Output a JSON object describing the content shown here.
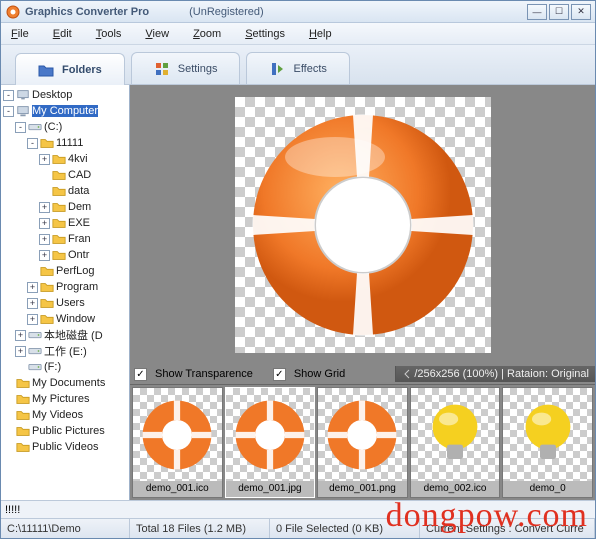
{
  "title": "Graphics Converter Pro",
  "title_suffix": "(UnRegistered)",
  "menu": [
    "File",
    "Edit",
    "Tools",
    "View",
    "Zoom",
    "Settings",
    "Help"
  ],
  "tabs": [
    {
      "label": "Folders",
      "icon": "folder"
    },
    {
      "label": "Settings",
      "icon": "settings"
    },
    {
      "label": "Effects",
      "icon": "effects"
    }
  ],
  "tree": [
    {
      "indent": 0,
      "exp": "-",
      "icon": "desktop",
      "label": "Desktop"
    },
    {
      "indent": 0,
      "exp": "-",
      "icon": "computer",
      "label": "My Computer",
      "sel": true
    },
    {
      "indent": 1,
      "exp": "-",
      "icon": "drive",
      "label": "(C:)"
    },
    {
      "indent": 2,
      "exp": "-",
      "icon": "folder",
      "label": "11111"
    },
    {
      "indent": 3,
      "exp": "+",
      "icon": "folder",
      "label": "4kvi"
    },
    {
      "indent": 3,
      "exp": " ",
      "icon": "folder",
      "label": "CAD"
    },
    {
      "indent": 3,
      "exp": " ",
      "icon": "folder",
      "label": "data"
    },
    {
      "indent": 3,
      "exp": "+",
      "icon": "folder",
      "label": "Dem"
    },
    {
      "indent": 3,
      "exp": "+",
      "icon": "folder",
      "label": "EXE"
    },
    {
      "indent": 3,
      "exp": "+",
      "icon": "folder",
      "label": "Fran"
    },
    {
      "indent": 3,
      "exp": "+",
      "icon": "folder",
      "label": "Ontr"
    },
    {
      "indent": 2,
      "exp": " ",
      "icon": "folder",
      "label": "PerfLog"
    },
    {
      "indent": 2,
      "exp": "+",
      "icon": "folder",
      "label": "Program"
    },
    {
      "indent": 2,
      "exp": "+",
      "icon": "folder",
      "label": "Users"
    },
    {
      "indent": 2,
      "exp": "+",
      "icon": "folder",
      "label": "Window"
    },
    {
      "indent": 1,
      "exp": "+",
      "icon": "drive",
      "label": "本地磁盘 (D"
    },
    {
      "indent": 1,
      "exp": "+",
      "icon": "drive",
      "label": "工作 (E:)"
    },
    {
      "indent": 1,
      "exp": " ",
      "icon": "drive",
      "label": "(F:)"
    },
    {
      "indent": 0,
      "exp": " ",
      "icon": "folder",
      "label": "My Documents"
    },
    {
      "indent": 0,
      "exp": " ",
      "icon": "folder",
      "label": "My Pictures"
    },
    {
      "indent": 0,
      "exp": " ",
      "icon": "folder",
      "label": "My Videos"
    },
    {
      "indent": 0,
      "exp": " ",
      "icon": "folder",
      "label": "Public Pictures"
    },
    {
      "indent": 0,
      "exp": " ",
      "icon": "folder",
      "label": "Public Videos"
    }
  ],
  "options": {
    "show_transparence": "Show Transparence",
    "show_grid": "Show Grid",
    "info": "/256x256 (100%)  |  Rataion: Original"
  },
  "thumbs": [
    {
      "name": "demo_001.ico",
      "kind": "ring",
      "sel": false
    },
    {
      "name": "demo_001.jpg",
      "kind": "ring",
      "sel": true
    },
    {
      "name": "demo_001.png",
      "kind": "ring",
      "sel": false
    },
    {
      "name": "demo_002.ico",
      "kind": "bulb",
      "sel": false
    },
    {
      "name": "demo_0",
      "kind": "bulb",
      "sel": false
    }
  ],
  "status": {
    "prev_path": "!!!!!",
    "path": "C:\\11111\\Demo",
    "files": "Total 18 Files (1.2 MB)",
    "selected": "0 File Selected (0 KB)",
    "settings": "Current Settings : Convert Curre"
  },
  "watermark": "dongpow.com"
}
